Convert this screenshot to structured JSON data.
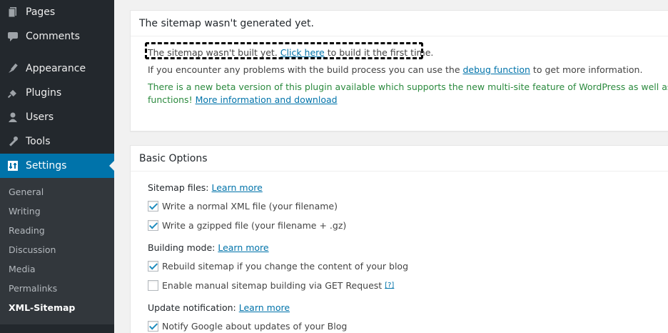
{
  "sidebar": {
    "items": [
      {
        "label": "Pages",
        "icon": "pages-icon"
      },
      {
        "label": "Comments",
        "icon": "comments-icon"
      },
      {
        "label": "Appearance",
        "icon": "appearance-icon"
      },
      {
        "label": "Plugins",
        "icon": "plugins-icon"
      },
      {
        "label": "Users",
        "icon": "users-icon"
      },
      {
        "label": "Tools",
        "icon": "tools-icon"
      },
      {
        "label": "Settings",
        "icon": "settings-icon"
      }
    ],
    "submenu": [
      "General",
      "Writing",
      "Reading",
      "Discussion",
      "Media",
      "Permalinks",
      "XML-Sitemap"
    ]
  },
  "status_box": {
    "title": "The sitemap wasn't generated yet.",
    "line1_pre": "The sitemap wasn't built yet. ",
    "line1_link": "Click here",
    "line1_post": " to build it the first time.",
    "line2_pre": "If you encounter any problems with the build process you can use the ",
    "line2_link": "debug function",
    "line2_post": " to get more information.",
    "line3": "There is a new beta version of this plugin available which supports the new multi-site feature of WordPress as well as many",
    "line4_pre": "functions! ",
    "line4_link": "More information and download"
  },
  "basic_options": {
    "title": "Basic Options",
    "learn_more": "Learn more",
    "help_glyph": "[?]",
    "sitemap_files_label": "Sitemap files:",
    "write_xml": "Write a normal XML file (your filename)",
    "write_gz": "Write a gzipped file (your filename + .gz)",
    "building_mode_label": "Building mode:",
    "rebuild": "Rebuild sitemap if you change the content of your blog",
    "manual": "Enable manual sitemap building via GET Request",
    "update_notification_label": "Update notification:",
    "notify_google": "Notify Google about updates of your Blog"
  },
  "colors": {
    "sidebar_bg": "#23282d",
    "active_bg": "#0073aa",
    "link": "#0073aa",
    "notice_green": "#2b8a3e"
  }
}
